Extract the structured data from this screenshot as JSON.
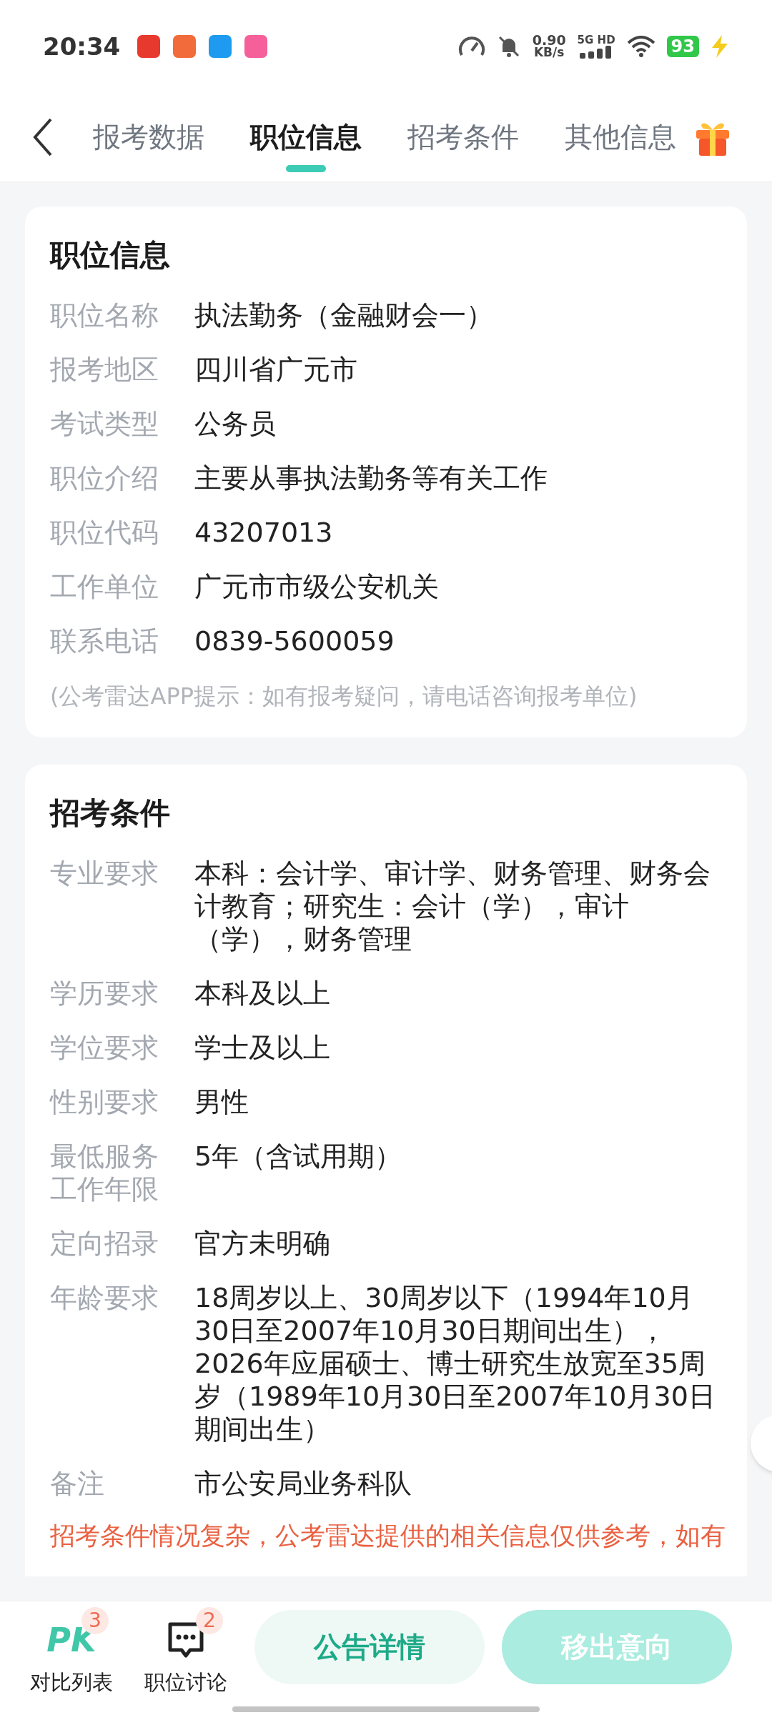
{
  "status_bar": {
    "time": "20:34",
    "net_speed": "0.90",
    "net_unit": "KB/s",
    "network": "5G HD",
    "battery": "93"
  },
  "tabs": [
    {
      "label": "报考数据",
      "selected": false
    },
    {
      "label": "职位信息",
      "selected": true
    },
    {
      "label": "招考条件",
      "selected": false
    },
    {
      "label": "其他信息",
      "selected": false
    }
  ],
  "position_card": {
    "title": "职位信息",
    "rows": [
      {
        "label": "职位名称",
        "value": "执法勤务（金融财会一）"
      },
      {
        "label": "报考地区",
        "value": "四川省广元市"
      },
      {
        "label": "考试类型",
        "value": "公务员"
      },
      {
        "label": "职位介绍",
        "value": "主要从事执法勤务等有关工作"
      },
      {
        "label": "职位代码",
        "value": "43207013"
      },
      {
        "label": "工作单位",
        "value": "广元市市级公安机关"
      },
      {
        "label": "联系电话",
        "value": "0839-5600059"
      }
    ],
    "hint": "(公考雷达APP提示：如有报考疑问，请电话咨询报考单位)"
  },
  "conditions_card": {
    "title": "招考条件",
    "rows": [
      {
        "label": "专业要求",
        "value": "本科：会计学、审计学、财务管理、财务会计教育；研究生：会计（学），审计（学），财务管理"
      },
      {
        "label": "学历要求",
        "value": "本科及以上"
      },
      {
        "label": "学位要求",
        "value": "学士及以上"
      },
      {
        "label": "性别要求",
        "value": "男性"
      },
      {
        "label": "最低服务工作年限",
        "value": "5年（含试用期）"
      },
      {
        "label": "定向招录",
        "value": "官方未明确"
      },
      {
        "label": "年龄要求",
        "value": "18周岁以上、30周岁以下（1994年10月30日至2007年10月30日期间出生），2026年应届硕士、博士研究生放宽至35周岁（1989年10月30日至2007年10月30日期间出生）"
      },
      {
        "label": "备注",
        "value": "市公安局业务科队"
      }
    ],
    "warning": "招考条件情况复杂，公考雷达提供的相关信息仅供参考，如有"
  },
  "bottom_bar": {
    "items": [
      {
        "kind": "pk",
        "icon_text": "PK",
        "label": "对比列表",
        "badge": "3"
      },
      {
        "kind": "chat",
        "label": "职位讨论",
        "badge": "2"
      }
    ],
    "buttons": [
      {
        "label": "公告详情",
        "kind": "secondary"
      },
      {
        "label": "移出意向",
        "kind": "primary"
      }
    ]
  }
}
